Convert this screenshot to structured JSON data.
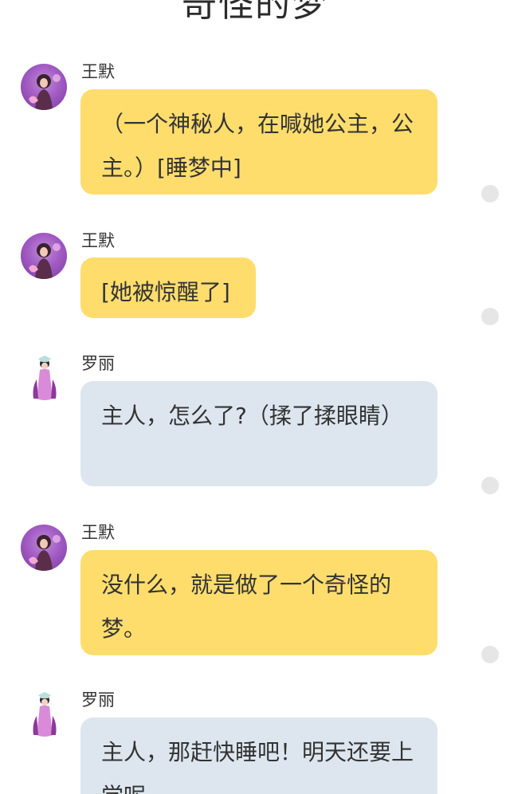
{
  "page_title": "奇怪的梦",
  "messages": [
    {
      "sender": "王默",
      "text": "（一个神秘人，在喊她公主，公主。）[睡梦中]",
      "avatar": "wang-mo-avatar",
      "bubble": "yellow"
    },
    {
      "sender": "王默",
      "text": "[她被惊醒了]",
      "avatar": "wang-mo-avatar",
      "bubble": "yellow"
    },
    {
      "sender": "罗丽",
      "text": "主人，怎么了?（揉了揉眼睛）",
      "avatar": "luo-li-avatar",
      "bubble": "gray"
    },
    {
      "sender": "王默",
      "text": "没什么，就是做了一个奇怪的梦。",
      "avatar": "wang-mo-avatar",
      "bubble": "yellow"
    },
    {
      "sender": "罗丽",
      "text": "主人，那赶快睡吧！明天还要上学呢",
      "avatar": "luo-li-avatar",
      "bubble": "gray"
    }
  ],
  "colors": {
    "bubble_yellow": "#fedd6d",
    "bubble_gray": "#dde6ef",
    "text": "#333333",
    "indicator_dot": "#e6e6e6"
  }
}
